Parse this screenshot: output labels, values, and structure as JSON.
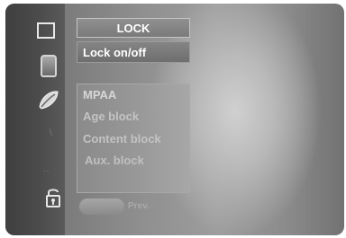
{
  "menu": {
    "title": "LOCK",
    "main_item": "Lock on/off",
    "sub_items": [
      "MPAA",
      "Age block",
      "Content block",
      "Aux. block"
    ],
    "prev_label": "Prev."
  },
  "sidebar": {
    "icons": [
      "picture-icon",
      "audio-icon",
      "leaf-icon",
      "dot-icon",
      "dots-icon",
      "lock-icon"
    ]
  },
  "colors": {
    "screen": "#8f8f8f",
    "sidebar": "#4b4b4b",
    "highlight_text": "#ffffff"
  }
}
